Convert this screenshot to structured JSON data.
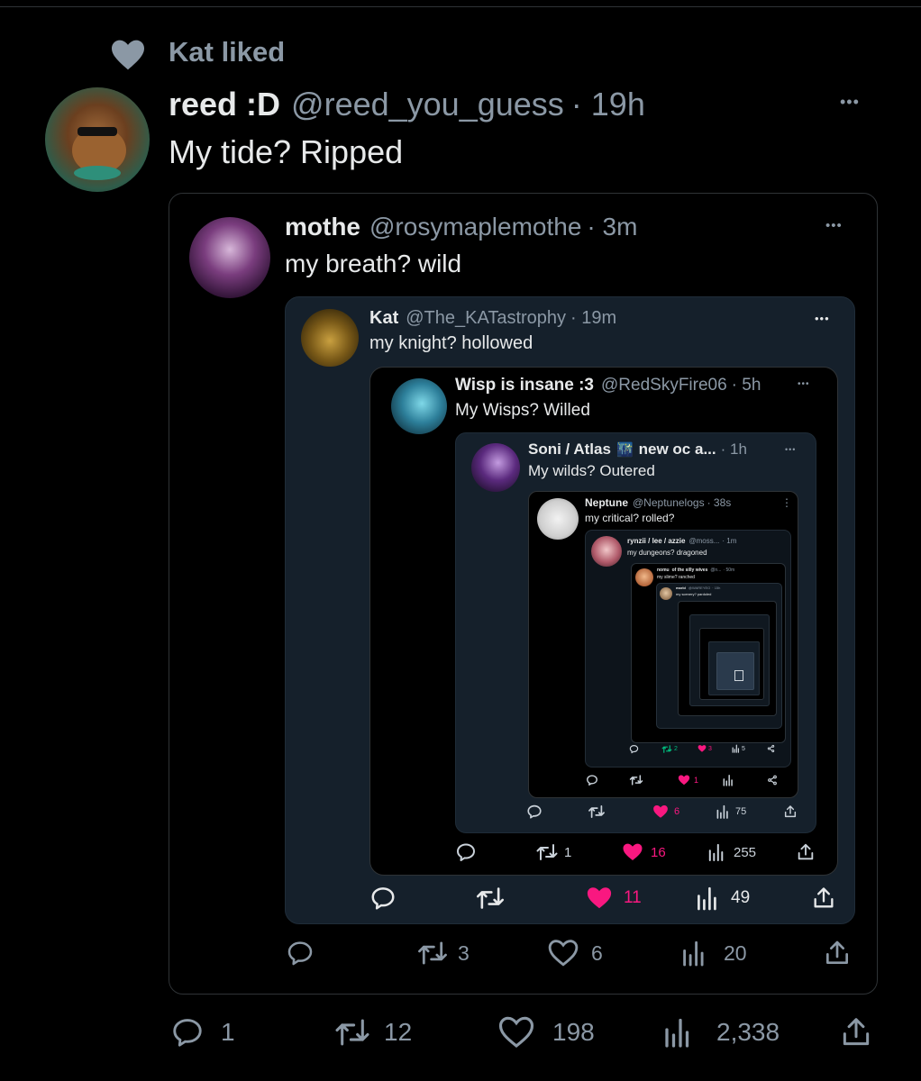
{
  "colors": {
    "background": "#000000",
    "card": "#15202b",
    "like": "#f91880",
    "muted": "#8b98a5",
    "border": "#2f3336"
  },
  "social_context": {
    "icon": "heart-icon",
    "text": "Kat liked"
  },
  "tweet": {
    "name": "reed :D",
    "handle": "@reed_you_guess",
    "time": "· 19h",
    "text": "My tide? Ripped",
    "more": "•••",
    "actions": {
      "replies": "1",
      "retweets": "12",
      "likes": "198",
      "views": "2,338"
    }
  },
  "q1": {
    "name": "mothe",
    "handle": "@rosymaplemothe",
    "time": "· 3m",
    "text": "my breath? wild",
    "more": "•••",
    "actions": {
      "retweets": "3",
      "likes": "6",
      "views": "20"
    }
  },
  "q2": {
    "name": "Kat",
    "handle": "@The_KATastrophy",
    "time": "· 19m",
    "text": "my knight? hollowed",
    "more": "•••",
    "actions": {
      "likes": "11",
      "views": "49"
    }
  },
  "q3": {
    "name": "Wisp is insane :3",
    "handle": "@RedSkyFire06",
    "time": "· 5h",
    "text": "My Wisps? Willed",
    "more": "•••",
    "actions": {
      "retweets": "1",
      "likes": "16",
      "views": "255"
    }
  },
  "q4": {
    "name": "Soni / Atlas",
    "badge": "🌃",
    "name_suffix": "new oc a...",
    "time": "· 1h",
    "text": "My wilds? Outered",
    "more": "•••",
    "actions": {
      "likes": "6",
      "views": "75"
    }
  },
  "q5": {
    "name": "Neptune",
    "handle": "@Neptunelogs",
    "time": "· 38s",
    "text": "my critical? rolled?",
    "more": "⋮",
    "actions": {
      "retweets": "",
      "likes": "1",
      "views": ""
    }
  },
  "q6": {
    "name": "rynzii / lee / azzie",
    "handle": "@moss...",
    "time": "· 1m",
    "text": "my dungeons? dragoned",
    "actions": {
      "retweets": "2",
      "likes": "3",
      "views": "5"
    }
  },
  "q7": {
    "name": "nomu",
    "name_suffix": "of the silly wives",
    "handle": "@n...",
    "time": "· 50m",
    "text": "my slime? ranched"
  },
  "q8": {
    "name": "marbl",
    "handle": "@WAREYEO",
    "time": "· 15h",
    "text": "my scenery? pardoled"
  }
}
